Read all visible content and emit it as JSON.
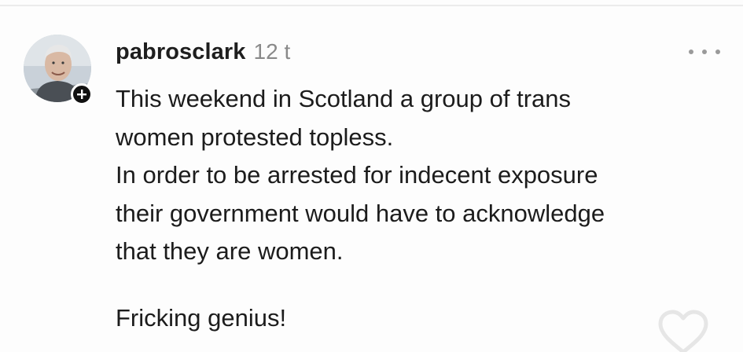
{
  "comment": {
    "username": "pabrosclark",
    "timestamp": "12 t",
    "lines": [
      "This weekend in Scotland a group of trans",
      "women protested topless.",
      "In order to be arrested for indecent exposure",
      "their government would have to acknowledge",
      "that they are women."
    ],
    "closing": "Fricking genius!"
  },
  "icons": {
    "follow": "plus-icon",
    "more": "more-horizontal-icon",
    "like": "heart-outline-icon"
  },
  "colors": {
    "username": "#1e1e1e",
    "timestamp": "#8a8a8a",
    "body_text": "#1c1c1c",
    "badge": "#111111",
    "divider": "#ececec"
  }
}
